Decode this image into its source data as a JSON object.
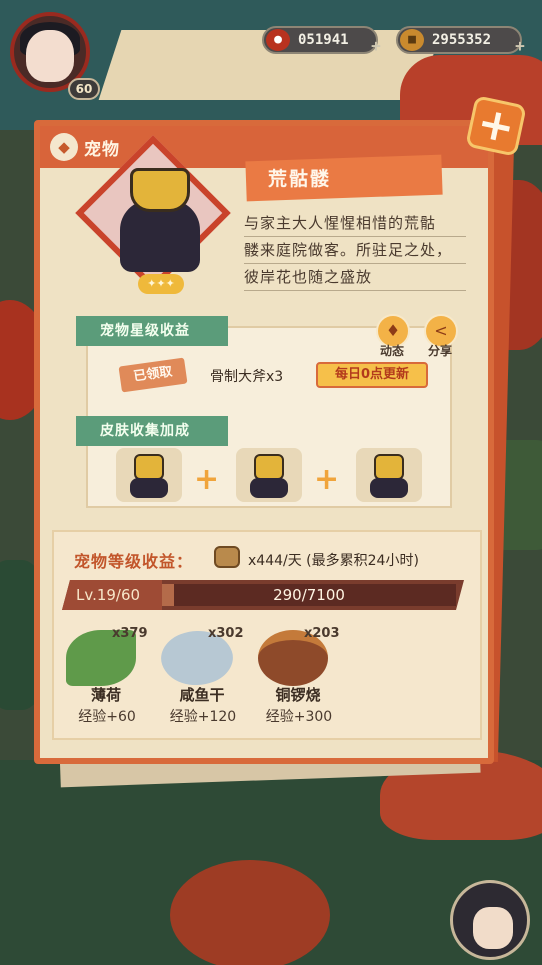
{
  "hud": {
    "player_level": "60",
    "currency_1_value": "051941",
    "currency_2_value": "2955352"
  },
  "panel": {
    "title": "宠物"
  },
  "pet": {
    "name": "荒骷髅",
    "description_lines": [
      "与家主大人惺惺相惜的荒骷",
      "髅来庭院做客。所驻足之处，",
      "彼岸花也随之盛放"
    ]
  },
  "star_benefit": {
    "section_title": "宠物星级收益",
    "claimed_label": "已领取",
    "reward": "骨制大斧x3",
    "daily_refresh": "每日0点更新"
  },
  "actions": {
    "moments_label": "动态",
    "share_label": "分享"
  },
  "skin_bonus": {
    "section_title": "皮肤收集加成"
  },
  "level_income": {
    "label": "宠物等级收益：",
    "rate": "x444/天  (最多累积24小时)",
    "level_text": "Lv.19/60",
    "xp_text": "290/7100",
    "xp_current": 290,
    "xp_max": 7100
  },
  "foods": [
    {
      "name": "薄荷",
      "count": "x379",
      "exp": "经验+60"
    },
    {
      "name": "咸鱼干",
      "count": "x302",
      "exp": "经验+120"
    },
    {
      "name": "铜锣烧",
      "count": "x203",
      "exp": "经验+300"
    }
  ],
  "icons": {
    "paw": "paw-icon",
    "close": "plus-close-icon",
    "moments": "bell-icon",
    "share": "share-icon",
    "wood": "wood-log-icon"
  }
}
